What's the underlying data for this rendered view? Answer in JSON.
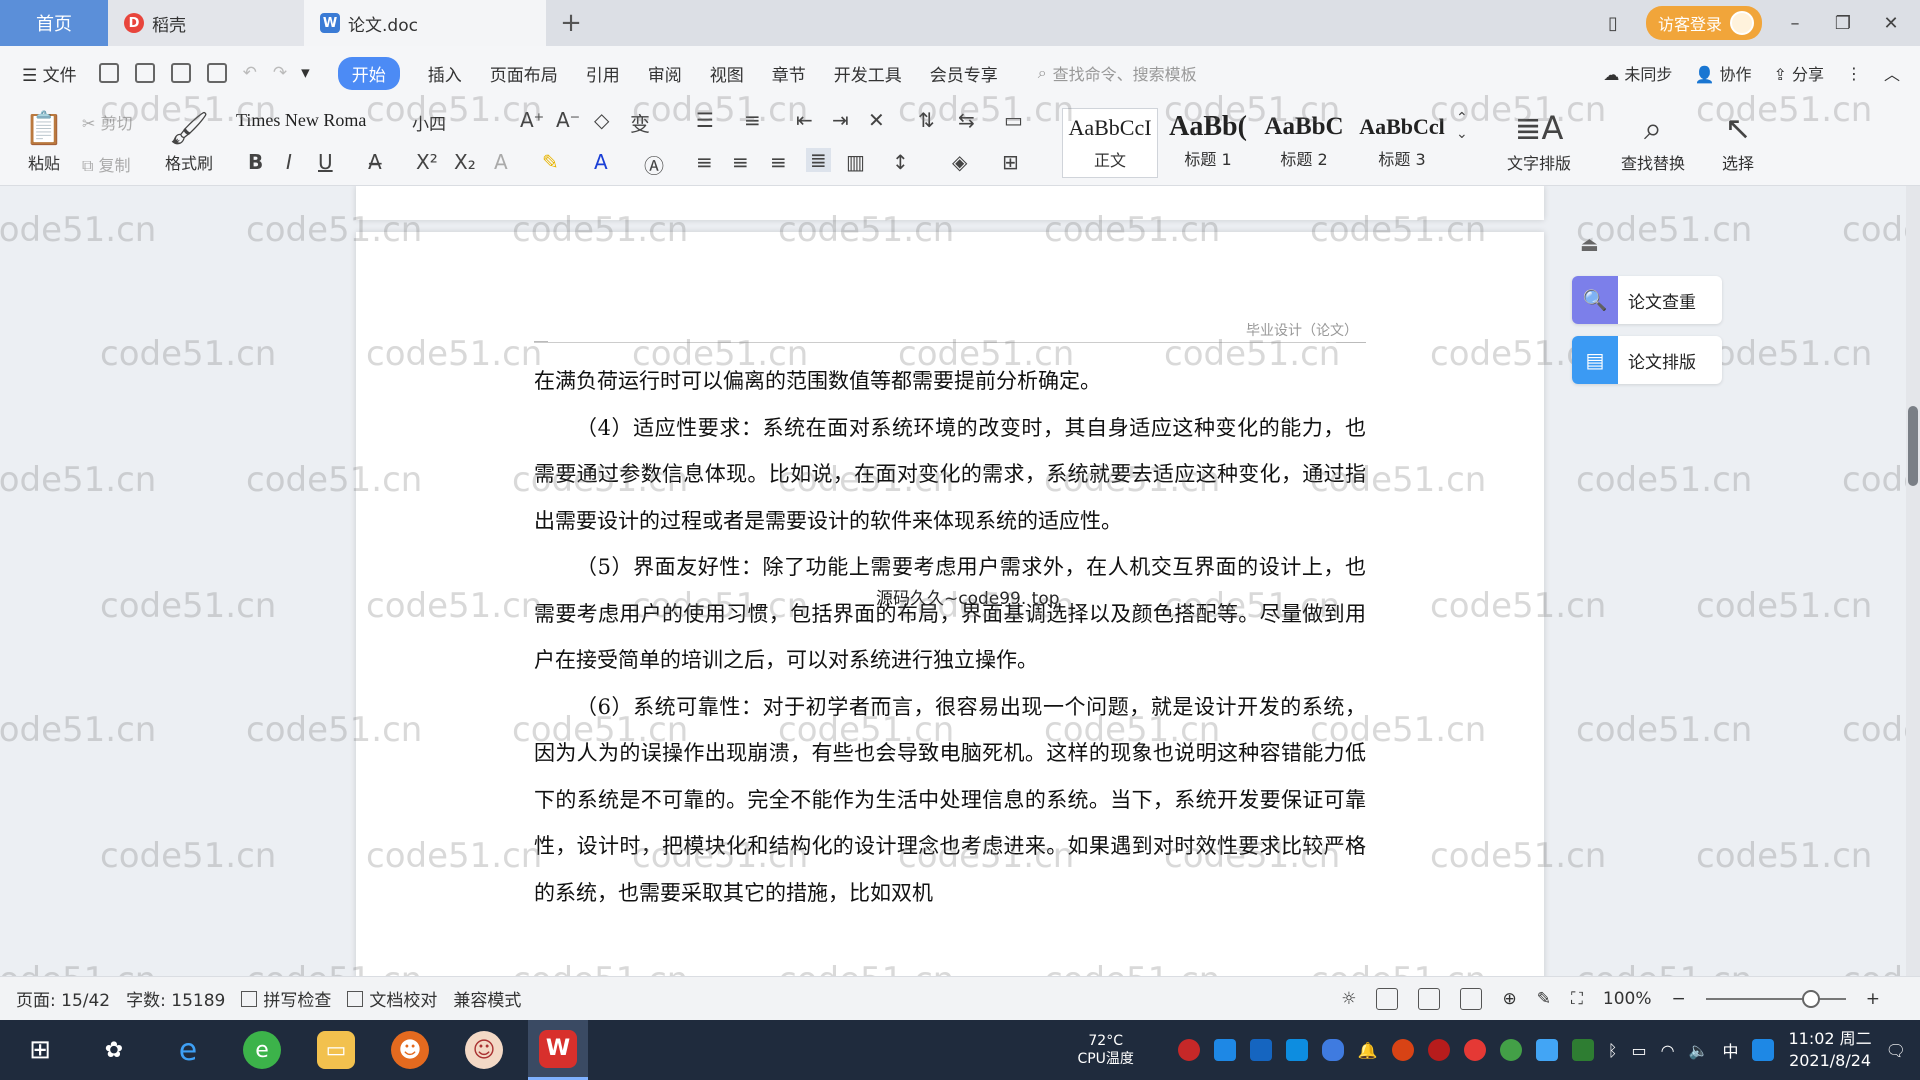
{
  "tabs": [
    {
      "label": "首页"
    },
    {
      "label": "稻壳"
    },
    {
      "label": "论文.doc"
    }
  ],
  "tabbar": {
    "login_label": "访客登录"
  },
  "menu": {
    "file": "文件",
    "items": [
      "开始",
      "插入",
      "页面布局",
      "引用",
      "审阅",
      "视图",
      "章节",
      "开发工具",
      "会员专享"
    ],
    "active_index": 0,
    "search_placeholder": "查找命令、搜索模板",
    "sync": "未同步",
    "collab": "协作",
    "share": "分享"
  },
  "ribbon": {
    "paste": "粘贴",
    "cut": "剪切",
    "copy": "复制",
    "format_painter": "格式刷",
    "font_name": "Times New Roma",
    "font_size": "小四",
    "styles": [
      {
        "sample": "AaBbCcI",
        "name": "正文"
      },
      {
        "sample": "AaBb(",
        "name": "标题 1"
      },
      {
        "sample": "AaBbC",
        "name": "标题 2"
      },
      {
        "sample": "AaBbCcl",
        "name": "标题 3"
      }
    ],
    "text_layout": "文字排版",
    "find_replace": "查找替换",
    "select": "选择"
  },
  "document": {
    "header": "毕业设计（论文）",
    "overlay_text": "源码久久~code99. top",
    "paragraphs": [
      {
        "indent": false,
        "text": "在满负荷运行时可以偏离的范围数值等都需要提前分析确定。"
      },
      {
        "indent": true,
        "text": "（4）适应性要求：系统在面对系统环境的改变时，其自身适应这种变化的能力，也需要通过参数信息体现。比如说，在面对变化的需求，系统就要去适应这种变化，通过指出需要设计的过程或者是需要设计的软件来体现系统的适应性。"
      },
      {
        "indent": true,
        "text": "（5）界面友好性：除了功能上需要考虑用户需求外，在人机交互界面的设计上，也需要考虑用户的使用习惯，包括界面的布局，界面基调选择以及颜色搭配等。尽量做到用户在接受简单的培训之后，可以对系统进行独立操作。"
      },
      {
        "indent": true,
        "text": "（6）系统可靠性：对于初学者而言，很容易出现一个问题，就是设计开发的系统，因为人为的误操作出现崩溃，有些也会导致电脑死机。这样的现象也说明这种容错能力低下的系统是不可靠的。完全不能作为生活中处理信息的系统。当下，系统开发要保证可靠性，设计时，把模块化和结构化的设计理念也考虑进来。如果遇到对时效性要求比较严格的系统，也需要采取其它的措施，比如双机"
      }
    ]
  },
  "watermark": "code51.cn",
  "side_panel": {
    "check": "论文查重",
    "layout": "论文排版"
  },
  "status": {
    "page": "页面: 15/42",
    "words": "字数: 15189",
    "spell": "拼写检查",
    "proof": "文档校对",
    "compat": "兼容模式",
    "zoom": "100%"
  },
  "taskbar": {
    "temp": "72°C",
    "temp_label": "CPU温度",
    "ime": "中",
    "time": "11:02 周二",
    "date": "2021/8/24"
  },
  "colors": {
    "accent": "#4c8bf5",
    "home_tab": "#5b8fd9",
    "login": "#f1a53a"
  }
}
